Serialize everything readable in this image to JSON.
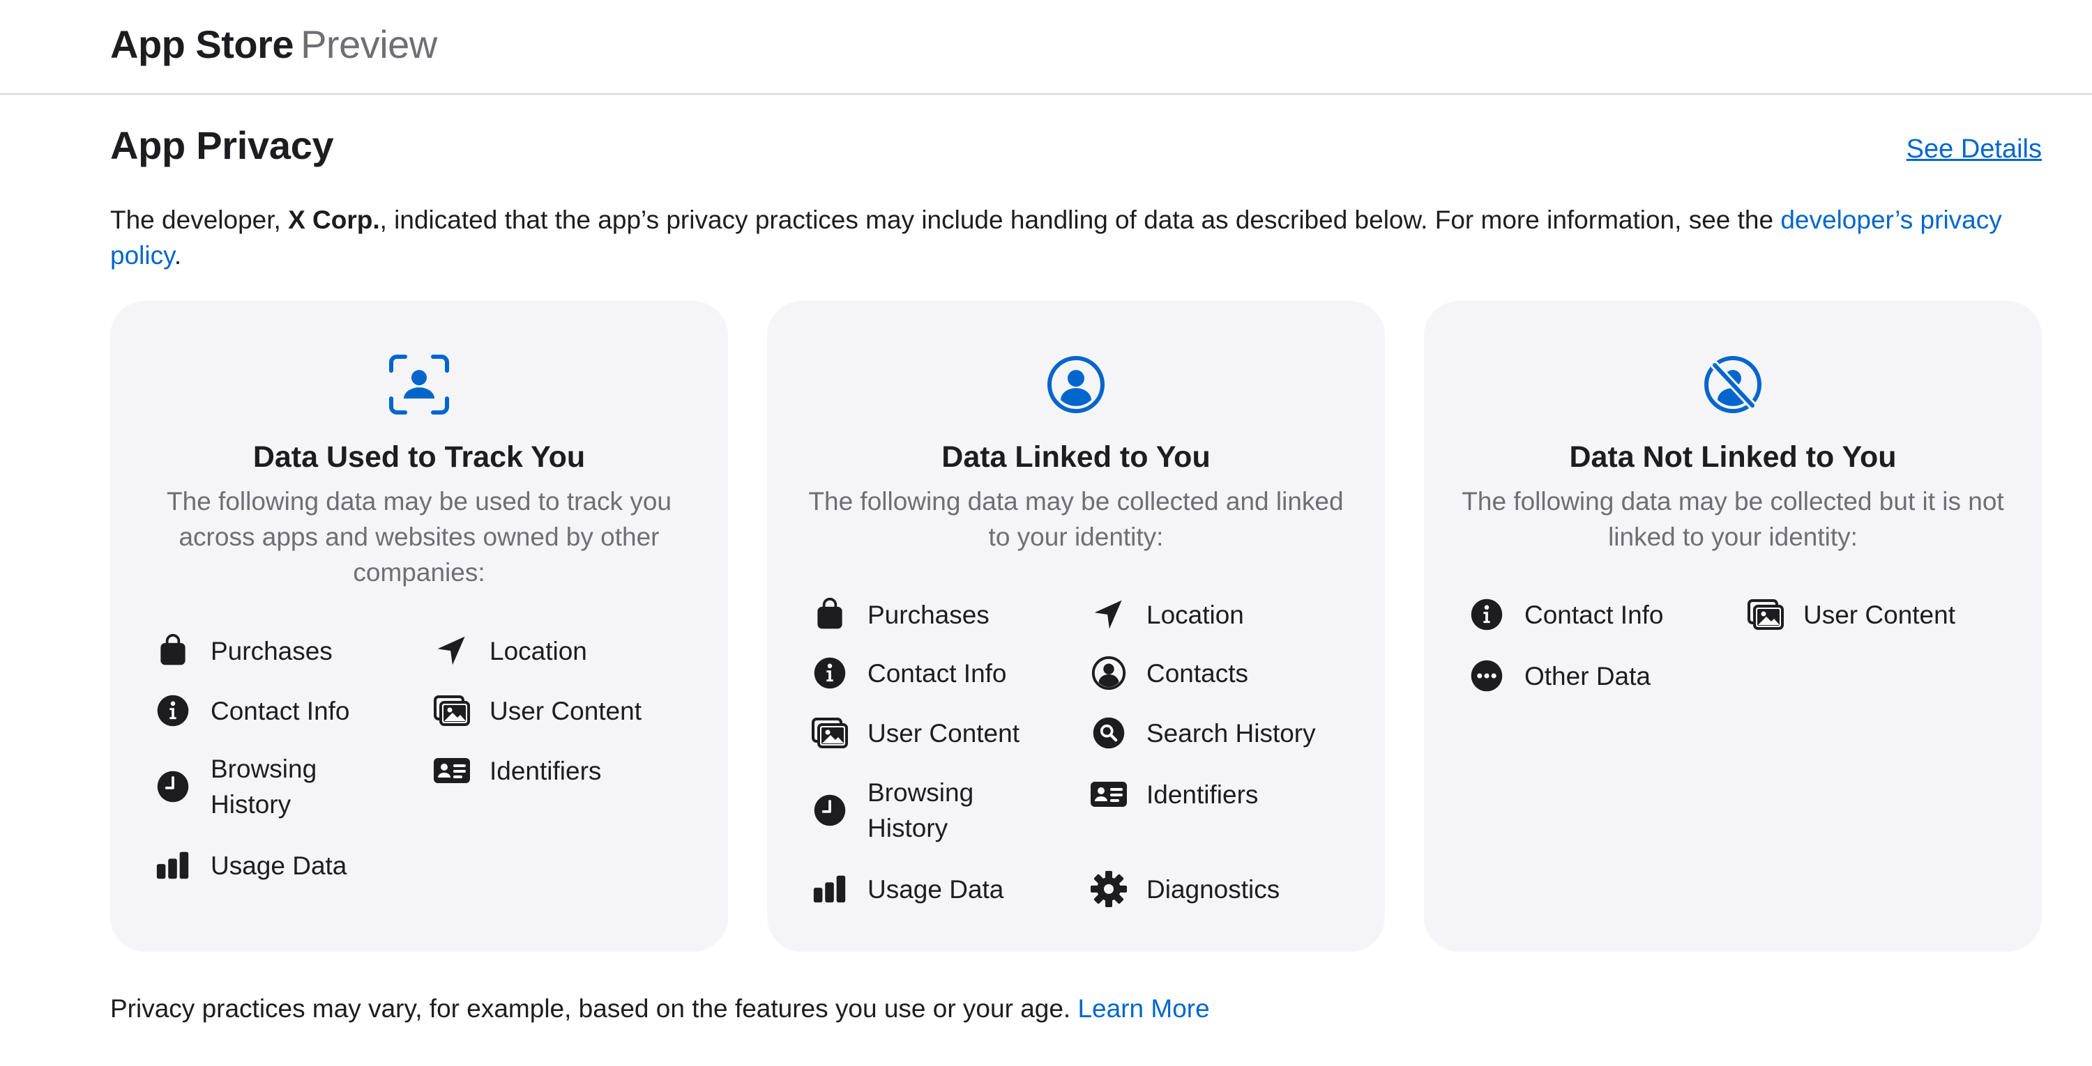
{
  "header": {
    "brand_main": "App Store",
    "brand_sub": "Preview"
  },
  "privacy": {
    "title": "App Privacy",
    "see_details": "See Details",
    "intro_before": "The developer, ",
    "developer": "X Corp.",
    "intro_after": ", indicated that the app’s privacy practices may include handling of data as described below. For more information, see the ",
    "policy_link": "developer’s privacy policy",
    "intro_end": "."
  },
  "cards": [
    {
      "title": "Data Used to Track You",
      "icon": "tracking-icon",
      "description": "The following data may be used to track you across apps and websites owned by other companies:",
      "items": [
        {
          "label": "Purchases",
          "icon": "bag-icon"
        },
        {
          "label": "Location",
          "icon": "location-arrow-icon"
        },
        {
          "label": "Contact Info",
          "icon": "info-circle-icon"
        },
        {
          "label": "User Content",
          "icon": "photos-icon"
        },
        {
          "label": "Browsing History",
          "icon": "clock-icon"
        },
        {
          "label": "Identifiers",
          "icon": "id-card-icon"
        },
        {
          "label": "Usage Data",
          "icon": "bar-chart-icon"
        }
      ]
    },
    {
      "title": "Data Linked to You",
      "icon": "person-circle-icon",
      "description": "The following data may be collected and linked to your identity:",
      "items": [
        {
          "label": "Purchases",
          "icon": "bag-icon"
        },
        {
          "label": "Location",
          "icon": "location-arrow-icon"
        },
        {
          "label": "Contact Info",
          "icon": "info-circle-icon"
        },
        {
          "label": "Contacts",
          "icon": "person-circle-icon"
        },
        {
          "label": "User Content",
          "icon": "photos-icon"
        },
        {
          "label": "Search History",
          "icon": "magnifier-icon"
        },
        {
          "label": "Browsing History",
          "icon": "clock-icon"
        },
        {
          "label": "Identifiers",
          "icon": "id-card-icon"
        },
        {
          "label": "Usage Data",
          "icon": "bar-chart-icon"
        },
        {
          "label": "Diagnostics",
          "icon": "gear-icon"
        }
      ]
    },
    {
      "title": "Data Not Linked to You",
      "icon": "person-slash-icon",
      "description": "The following data may be collected but it is not linked to your identity:",
      "items": [
        {
          "label": "Contact Info",
          "icon": "info-circle-icon"
        },
        {
          "label": "User Content",
          "icon": "photos-icon"
        },
        {
          "label": "Other Data",
          "icon": "ellipsis-circle-icon"
        }
      ]
    }
  ],
  "footer": {
    "text": "Privacy practices may vary, for example, based on the features you use or your age.",
    "learn_more": "Learn More"
  },
  "colors": {
    "accent": "#0066cc",
    "card_bg": "#f5f5f7",
    "text": "#1d1d1f",
    "secondary_text": "#6e6e73"
  }
}
